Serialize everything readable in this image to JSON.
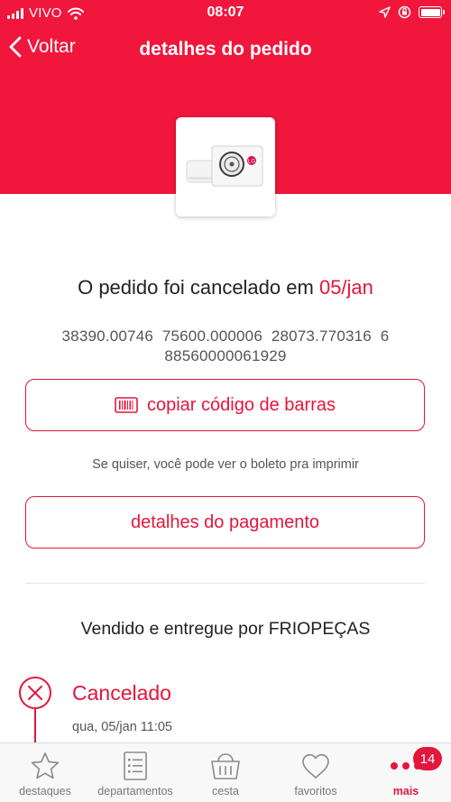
{
  "status_bar": {
    "carrier": "VIVO",
    "time": "08:07"
  },
  "nav": {
    "back_label": "Voltar",
    "title": "detalhes do pedido"
  },
  "colors": {
    "brand_red": "#f0163c",
    "accent_red": "#e3163c"
  },
  "order": {
    "status_prefix": "O pedido foi cancelado em",
    "status_date": "05/jan",
    "barcode_line1": "38390.00746  75600.000006  28073.770316  6",
    "barcode_line2": "88560000061929",
    "copy_barcode_label": "copiar código de barras",
    "boleto_hint": "Se quiser, você pode ver o boleto pra imprimir",
    "payment_details_label": "detalhes do pagamento",
    "seller_text": "Vendido e entregue por FRIOPEÇAS"
  },
  "timeline": {
    "status_title": "Cancelado",
    "status_date": "qua, 05/jan 11:05"
  },
  "tab_bar": {
    "tabs": [
      {
        "label": "destaques",
        "icon": "star-icon"
      },
      {
        "label": "departamentos",
        "icon": "list-icon"
      },
      {
        "label": "cesta",
        "icon": "basket-icon"
      },
      {
        "label": "favoritos",
        "icon": "heart-icon"
      },
      {
        "label": "mais",
        "icon": "more-icon"
      }
    ],
    "badge_count": "14"
  }
}
